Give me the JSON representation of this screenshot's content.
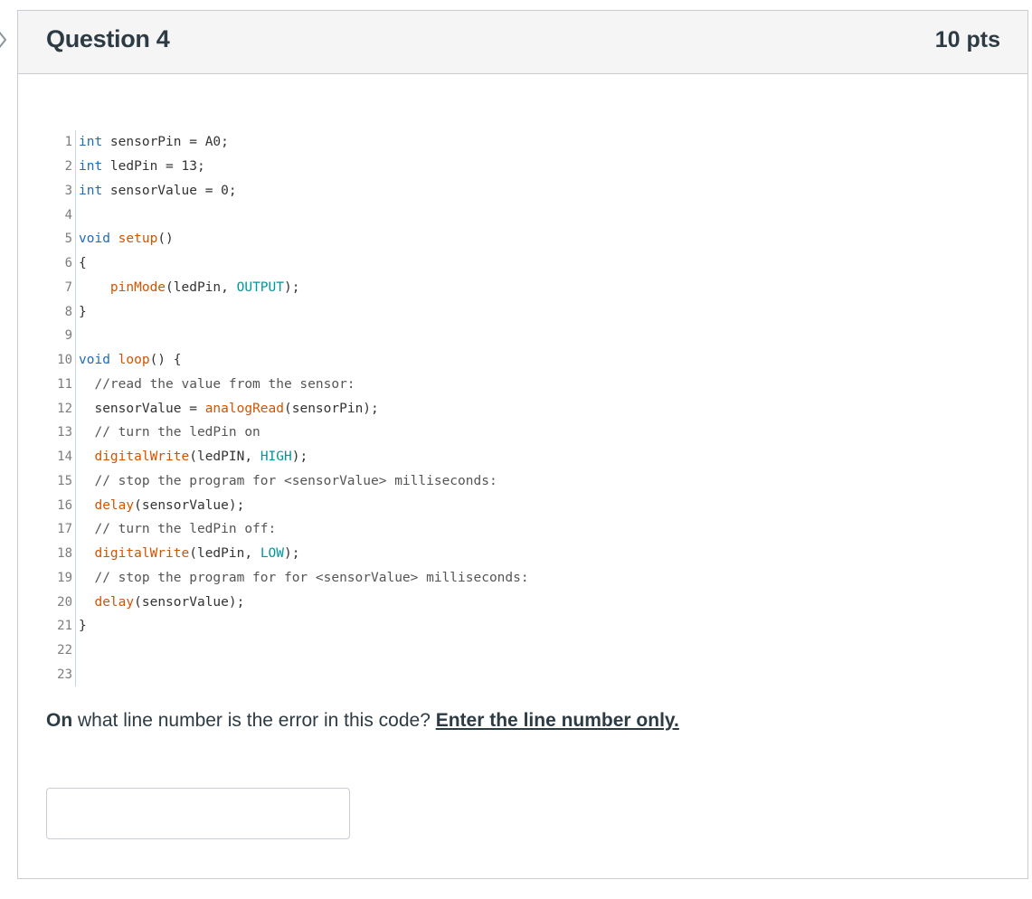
{
  "question": {
    "title": "Question 4",
    "points": "10 pts"
  },
  "code": {
    "lines": [
      {
        "num": "1",
        "parts": [
          {
            "t": "int",
            "c": "kw"
          },
          {
            "t": " sensorPin = A0;",
            "c": ""
          }
        ]
      },
      {
        "num": "2",
        "parts": [
          {
            "t": "int",
            "c": "kw"
          },
          {
            "t": " ledPin = 13;",
            "c": ""
          }
        ]
      },
      {
        "num": "3",
        "parts": [
          {
            "t": "int",
            "c": "kw"
          },
          {
            "t": " sensorValue = 0;",
            "c": ""
          }
        ]
      },
      {
        "num": "4",
        "parts": []
      },
      {
        "num": "5",
        "parts": [
          {
            "t": "void",
            "c": "kw"
          },
          {
            "t": " ",
            "c": ""
          },
          {
            "t": "setup",
            "c": "fn"
          },
          {
            "t": "()",
            "c": ""
          }
        ]
      },
      {
        "num": "6",
        "parts": [
          {
            "t": "{",
            "c": ""
          }
        ]
      },
      {
        "num": "7",
        "parts": [
          {
            "t": "    ",
            "c": ""
          },
          {
            "t": "pinMode",
            "c": "fn"
          },
          {
            "t": "(ledPin, ",
            "c": ""
          },
          {
            "t": "OUTPUT",
            "c": "const"
          },
          {
            "t": ");",
            "c": ""
          }
        ]
      },
      {
        "num": "8",
        "parts": [
          {
            "t": "}",
            "c": ""
          }
        ]
      },
      {
        "num": "9",
        "parts": []
      },
      {
        "num": "10",
        "parts": [
          {
            "t": "void",
            "c": "kw"
          },
          {
            "t": " ",
            "c": ""
          },
          {
            "t": "loop",
            "c": "fn"
          },
          {
            "t": "() {",
            "c": ""
          }
        ]
      },
      {
        "num": "11",
        "parts": [
          {
            "t": "  //read the value from the sensor:",
            "c": "cm"
          }
        ]
      },
      {
        "num": "12",
        "parts": [
          {
            "t": "  sensorValue = ",
            "c": ""
          },
          {
            "t": "analogRead",
            "c": "fn"
          },
          {
            "t": "(sensorPin);",
            "c": ""
          }
        ]
      },
      {
        "num": "13",
        "parts": [
          {
            "t": "  // turn the ledPin on",
            "c": "cm"
          }
        ]
      },
      {
        "num": "14",
        "parts": [
          {
            "t": "  ",
            "c": ""
          },
          {
            "t": "digitalWrite",
            "c": "fn"
          },
          {
            "t": "(ledPIN, ",
            "c": ""
          },
          {
            "t": "HIGH",
            "c": "const"
          },
          {
            "t": ");",
            "c": ""
          }
        ]
      },
      {
        "num": "15",
        "parts": [
          {
            "t": "  // stop the program for <sensorValue> milliseconds:",
            "c": "cm"
          }
        ]
      },
      {
        "num": "16",
        "parts": [
          {
            "t": "  ",
            "c": ""
          },
          {
            "t": "delay",
            "c": "fn"
          },
          {
            "t": "(sensorValue);",
            "c": ""
          }
        ]
      },
      {
        "num": "17",
        "parts": [
          {
            "t": "  // turn the ledPin off:",
            "c": "cm"
          }
        ]
      },
      {
        "num": "18",
        "parts": [
          {
            "t": "  ",
            "c": ""
          },
          {
            "t": "digitalWrite",
            "c": "fn"
          },
          {
            "t": "(ledPin, ",
            "c": ""
          },
          {
            "t": "LOW",
            "c": "const"
          },
          {
            "t": ");",
            "c": ""
          }
        ]
      },
      {
        "num": "19",
        "parts": [
          {
            "t": "  // stop the program for for <sensorValue> milliseconds:",
            "c": "cm"
          }
        ]
      },
      {
        "num": "20",
        "parts": [
          {
            "t": "  ",
            "c": ""
          },
          {
            "t": "delay",
            "c": "fn"
          },
          {
            "t": "(sensorValue);",
            "c": ""
          }
        ]
      },
      {
        "num": "21",
        "parts": [
          {
            "t": "}",
            "c": ""
          }
        ]
      },
      {
        "num": "22",
        "parts": []
      },
      {
        "num": "23",
        "parts": []
      }
    ]
  },
  "prompt": {
    "bold_word": "On",
    "text": " what line number is the error in this code? ",
    "underline": "Enter the line number only."
  },
  "answer": {
    "value": "",
    "placeholder": ""
  },
  "colors": {
    "keyword": "#1e6bb8",
    "function": "#d35400",
    "constant": "#00979c"
  },
  "icons": {
    "nav": "chevron-right-icon"
  }
}
